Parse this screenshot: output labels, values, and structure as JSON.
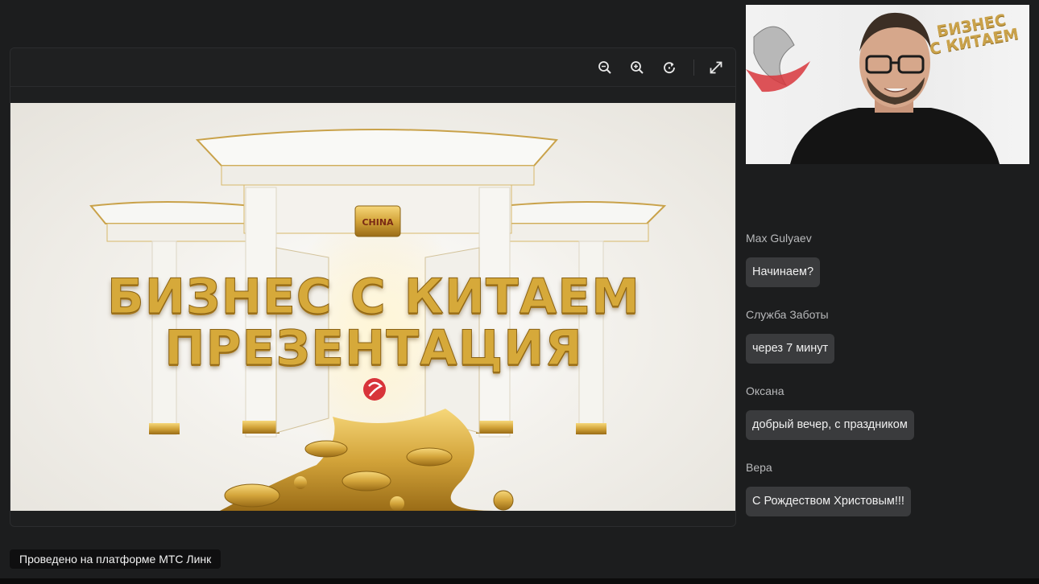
{
  "slide": {
    "title_line1": "БИЗНЕС С КИТАЕМ",
    "title_line2": "ПРЕЗЕНТАЦИЯ",
    "sign_text": "CHINA"
  },
  "toolbar": {
    "zoom_out": "zoom-out-icon",
    "zoom_in": "zoom-in-icon",
    "rotate": "rotate-icon",
    "fullscreen": "fullscreen-icon"
  },
  "video": {
    "brand_line1": "БИЗНЕС",
    "brand_line2": "С КИТАЕМ"
  },
  "chat": {
    "messages": [
      {
        "author": "Max Gulyaev",
        "text": "Начинаем?"
      },
      {
        "author": "Служба Заботы",
        "text": "через 7 минут"
      },
      {
        "author": "Оксана",
        "text": "добрый вечер, с праздником"
      },
      {
        "author": "Вера",
        "text": "С Рождеством Христовым!!!"
      }
    ]
  },
  "footer": {
    "platform_label": "Проведено на платформе МТС Линк"
  },
  "colors": {
    "background": "#1c1d1e",
    "bubble": "#3a3b3d",
    "gold": "#d6a93a"
  }
}
